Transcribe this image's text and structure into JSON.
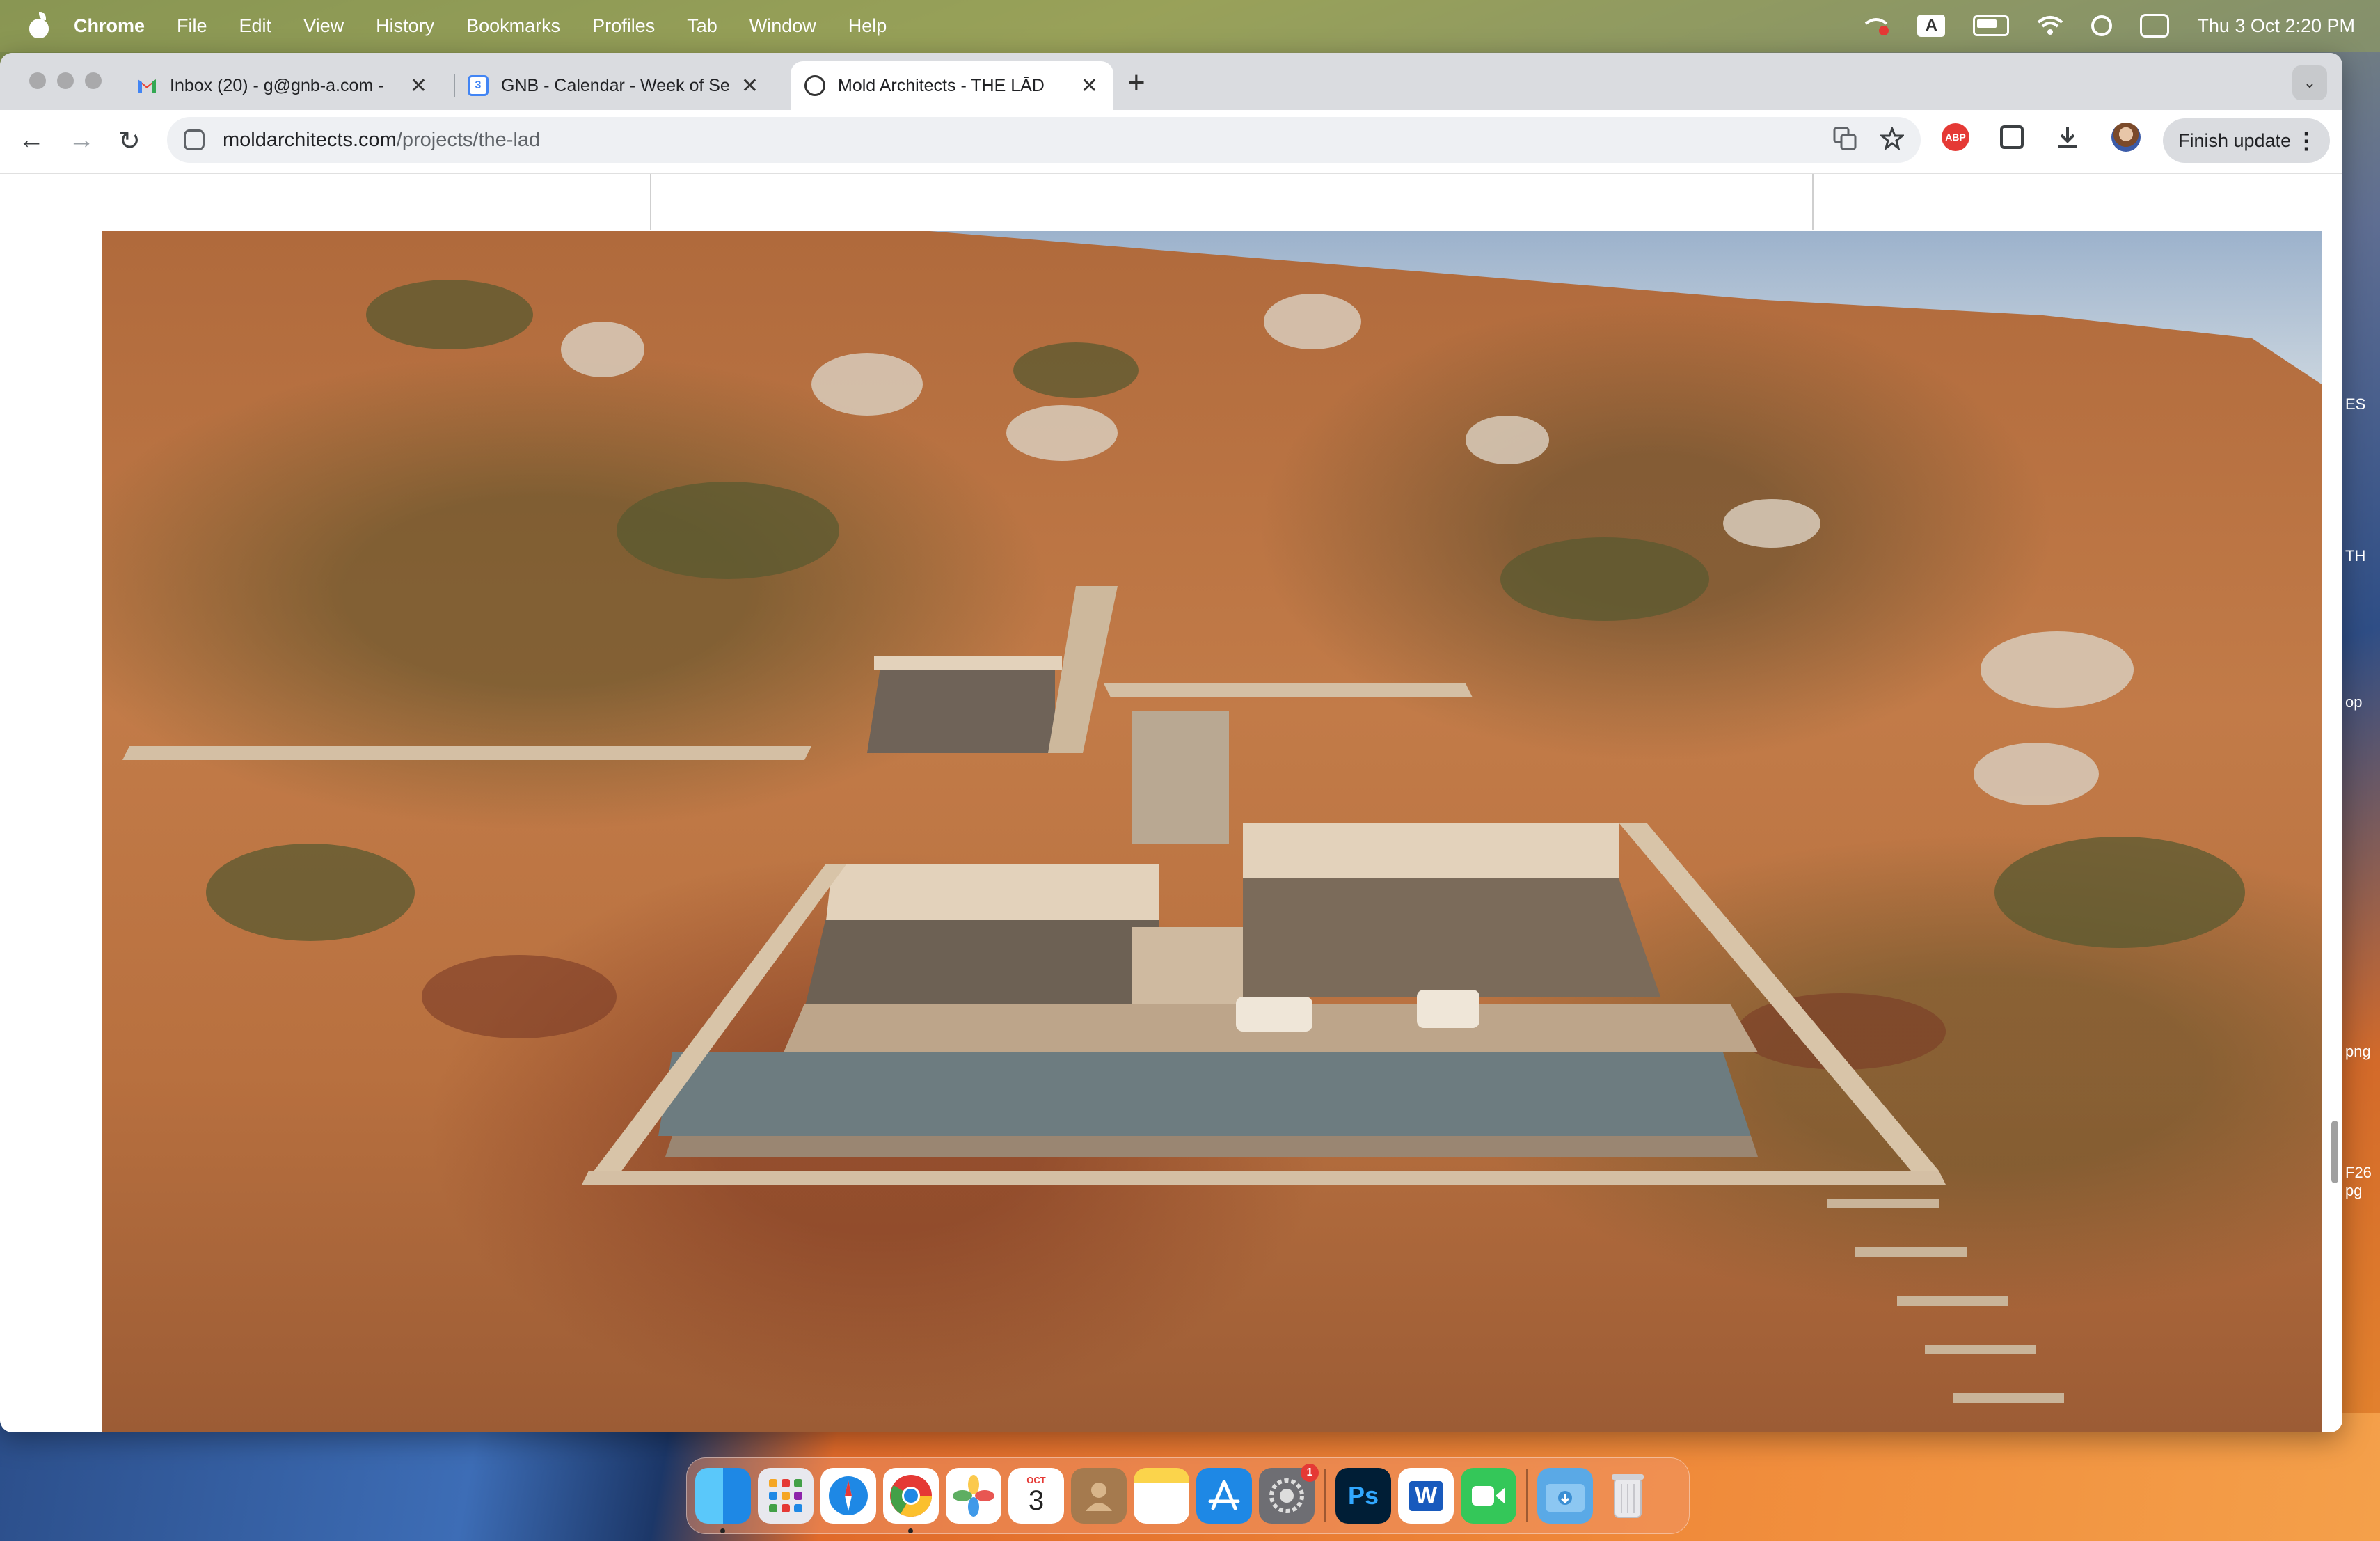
{
  "menubar": {
    "app_name": "Chrome",
    "items": [
      "File",
      "Edit",
      "View",
      "History",
      "Bookmarks",
      "Profiles",
      "Tab",
      "Window",
      "Help"
    ],
    "input_badge": "A",
    "clock": "Thu 3 Oct  2:20 PM"
  },
  "tabs": [
    {
      "title": "Inbox (20) - g@gnb-a.com - ",
      "favicon": "gmail-icon",
      "active": false
    },
    {
      "title": "GNB - Calendar - Week of Se",
      "favicon": "calendar-icon",
      "favicon_text": "3",
      "active": false
    },
    {
      "title": "Mold Architects - THE LĀD",
      "favicon": "mold-icon",
      "active": true
    }
  ],
  "toolbar": {
    "url_host": "moldarchitects.com",
    "url_path": "/projects/the-lad",
    "adblock_label": "ABP",
    "update_label": "Finish update"
  },
  "side_labels": [
    "ES",
    "TH",
    "op",
    "png",
    "F26\npg"
  ],
  "dock": {
    "calendar_month": "OCT",
    "calendar_day": "3",
    "settings_badge": "1",
    "ps_label": "Ps",
    "word_label": "W"
  },
  "colors": {
    "accent_red": "#e53935",
    "tab_strip": "#dadce0",
    "terrain": "#b8703f"
  }
}
